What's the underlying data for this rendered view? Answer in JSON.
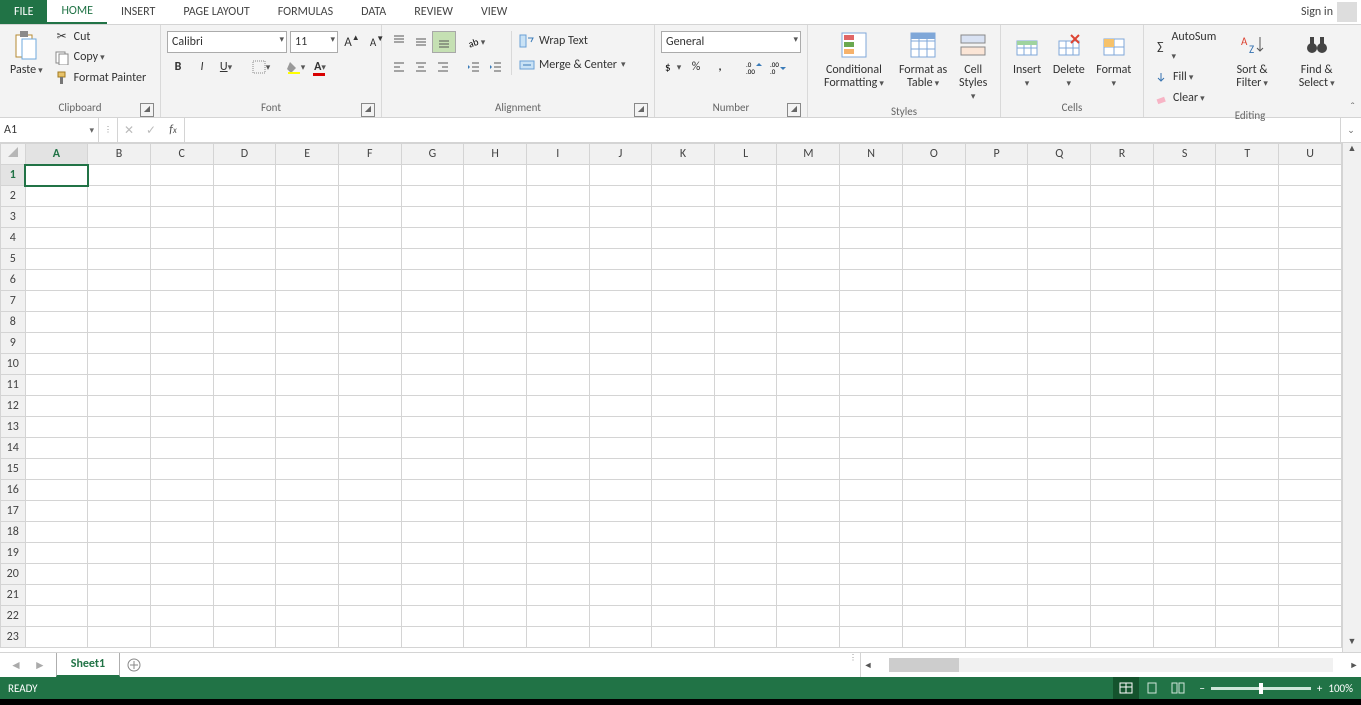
{
  "tabs": {
    "file": "FILE",
    "items": [
      "HOME",
      "INSERT",
      "PAGE LAYOUT",
      "FORMULAS",
      "DATA",
      "REVIEW",
      "VIEW"
    ],
    "active": 0,
    "signin": "Sign in"
  },
  "ribbon": {
    "clipboard": {
      "label": "Clipboard",
      "paste": "Paste",
      "cut": "Cut",
      "copy": "Copy",
      "format_painter": "Format Painter"
    },
    "font": {
      "label": "Font",
      "name": "Calibri",
      "size": "11"
    },
    "alignment": {
      "label": "Alignment",
      "wrap": "Wrap Text",
      "merge": "Merge & Center"
    },
    "number": {
      "label": "Number",
      "format": "General"
    },
    "styles": {
      "label": "Styles",
      "cond": "Conditional Formatting",
      "table": "Format as Table",
      "cell": "Cell Styles"
    },
    "cells": {
      "label": "Cells",
      "insert": "Insert",
      "delete": "Delete",
      "format": "Format"
    },
    "editing": {
      "label": "Editing",
      "autosum": "AutoSum",
      "fill": "Fill",
      "clear": "Clear",
      "sort": "Sort & Filter",
      "find": "Find & Select"
    }
  },
  "namebox": "A1",
  "formula": "",
  "columns": [
    "A",
    "B",
    "C",
    "D",
    "E",
    "F",
    "G",
    "H",
    "I",
    "J",
    "K",
    "L",
    "M",
    "N",
    "O",
    "P",
    "Q",
    "R",
    "S",
    "T",
    "U"
  ],
  "rows": [
    "1",
    "2",
    "3",
    "4",
    "5",
    "6",
    "7",
    "8",
    "9",
    "10",
    "11",
    "12",
    "13",
    "14",
    "15",
    "16",
    "17",
    "18",
    "19",
    "20",
    "21",
    "22",
    "23"
  ],
  "selected_col": "A",
  "selected_row": "1",
  "sheet_tabs": {
    "active": "Sheet1"
  },
  "status": {
    "ready": "READY",
    "zoom": "100%"
  }
}
